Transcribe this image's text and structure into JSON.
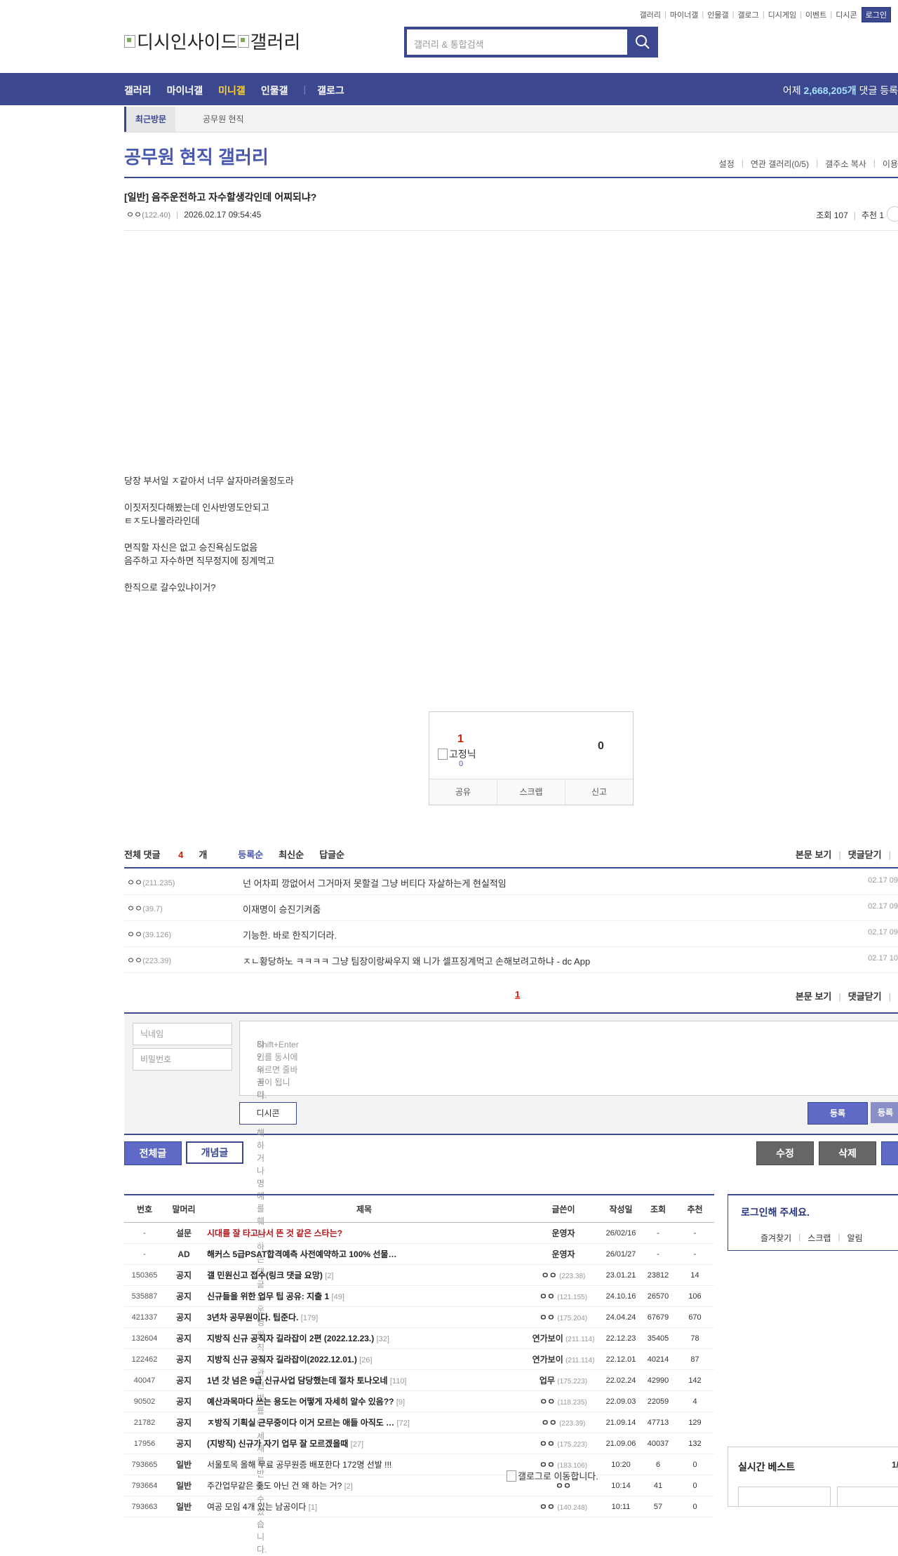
{
  "util_menu": [
    "갤러리",
    "마이너갤",
    "인물갤",
    "갤로그",
    "디시게임",
    "이벤트",
    "디시콘"
  ],
  "login_label": "로그인",
  "logo_alt_1": "디시인사이드",
  "logo_alt_2": "갤러리",
  "search_placeholder": "갤러리 & 통합검색",
  "gnb": {
    "items": [
      "갤러리",
      "마이너갤",
      "미니갤",
      "인물갤",
      "갤로그"
    ],
    "count_prefix": "어제",
    "count_value": "2,668,205개",
    "count_suffix": "댓글 등록"
  },
  "visit": {
    "tab": "최근방문",
    "item": "공무원 현직"
  },
  "gallery_title": "공무원 현직 갤러리",
  "gallery_menu": [
    "설정",
    "연관 갤러리(0/5)",
    "갤주소 복사",
    "이용"
  ],
  "post": {
    "title": "[일반] 음주운전하고 자수할생각인데 어찌되냐?",
    "nick": "ㅇㅇ",
    "ip": "(122.40)",
    "date": "2026.02.17 09:54:45",
    "views": "조회 107",
    "recommend": "추천 1",
    "body": [
      "당장 부서일 ㅈ같아서 너무 살자마려울정도라",
      "",
      "이짓저짓다해봤는데 인사반영도안되고",
      "ㅌㅈ도나몰라라인데",
      "",
      "면직할 자신은 없고 승진욕심도없음",
      "음주하고 자수하면 직무정지에 징계먹고",
      "",
      "한직으로 갈수있냐이거?"
    ]
  },
  "vote": {
    "up": "1",
    "fixed_alt": "고정닉",
    "fixed_count": "0",
    "down": "0",
    "share": "공유",
    "scrap": "스크랩",
    "report": "신고"
  },
  "comments": {
    "total_label": "전체 댓글",
    "total_count": "4",
    "total_unit": "개",
    "sort": [
      "등록순",
      "최신순",
      "답글순"
    ],
    "view_body": "본문 보기",
    "close": "댓글닫기",
    "items": [
      {
        "nick": "ㅇㅇ",
        "ip": "(211.235)",
        "text": "넌 어차피 깡없어서 그거마저 못할걸 그냥 버티다 자살하는게 현실적임",
        "date": "02.17 09"
      },
      {
        "nick": "ㅇㅇ",
        "ip": "(39.7)",
        "text": "이재명이 승진기켜줌",
        "date": "02.17 09"
      },
      {
        "nick": "ㅇㅇ",
        "ip": "(39.126)",
        "text": "기능한. 바로 한직기더라.",
        "date": "02.17 09"
      },
      {
        "nick": "ㅇㅇ",
        "ip": "(223.39)",
        "text": "ㅈㄴ황당하노 ㅋㅋㅋㅋ 그냥 팀장이랑싸우지 왜 니가 셀프징계먹고 손해보려고하냐 - dc App",
        "date": "02.17 10"
      }
    ],
    "page": "1"
  },
  "form": {
    "nick_placeholder": "닉네임",
    "pw_placeholder": "비밀번호",
    "textarea_line1": "타인의 권리를 침해하거나 명예를 훼손하는 댓글은 운영원칙 및 관련 법률에 제재를 받을 수 있습니다.",
    "textarea_line2": "Shift+Enter 키를 동시에 누르면 줄바꿈이 됩니다.",
    "dccon": "디시콘",
    "submit": "등록",
    "submit2": "등록"
  },
  "buttons": {
    "all": "전체글",
    "concept": "개념글",
    "edit": "수정",
    "delete": "삭제"
  },
  "list": {
    "headers": [
      "번호",
      "말머리",
      "제목",
      "글쓴이",
      "작성일",
      "조회",
      "추천"
    ],
    "rows": [
      {
        "no": "-",
        "head": "설문",
        "title": "시대를 잘 타고나서 뜬 것 같은 스타는?",
        "replies": "",
        "writer": "운영자",
        "ip": "",
        "date": "26/02/16",
        "views": "-",
        "rec": "-",
        "style": "red"
      },
      {
        "no": "-",
        "head": "AD",
        "title": "해커스 5급PSAT합격예측 사전예약하고 100% 선물…",
        "replies": "",
        "writer": "운영자",
        "ip": "",
        "date": "26/01/27",
        "views": "-",
        "rec": "-",
        "style": "bold"
      },
      {
        "no": "150365",
        "head": "공지",
        "title": "갤 민원신고 접수(링크 댓글 요망)",
        "replies": "[2]",
        "writer": "ㅇㅇ",
        "ip": "(223.38)",
        "date": "23.01.21",
        "views": "23812",
        "rec": "14",
        "style": "bold"
      },
      {
        "no": "535887",
        "head": "공지",
        "title": "신규들을 위한 업무 팁 공유: 지출 1",
        "replies": "[49]",
        "writer": "ㅇㅇ",
        "ip": "(121.155)",
        "date": "24.10.16",
        "views": "26570",
        "rec": "106",
        "style": "bold"
      },
      {
        "no": "421337",
        "head": "공지",
        "title": "3년차 공무원이다. 팁준다.",
        "replies": "[179]",
        "writer": "ㅇㅇ",
        "ip": "(175.204)",
        "date": "24.04.24",
        "views": "67679",
        "rec": "670",
        "style": "bold"
      },
      {
        "no": "132604",
        "head": "공지",
        "title": "지방직 신규 공직자 길라잡이 2편 (2022.12.23.)",
        "replies": "[32]",
        "writer": "연가보이",
        "ip": "(211.114)",
        "date": "22.12.23",
        "views": "35405",
        "rec": "78",
        "style": "bold"
      },
      {
        "no": "122462",
        "head": "공지",
        "title": "지방직 신규 공직자 길라잡이(2022.12.01.)",
        "replies": "[26]",
        "writer": "연가보이",
        "ip": "(211.114)",
        "date": "22.12.01",
        "views": "40214",
        "rec": "87",
        "style": "bold"
      },
      {
        "no": "40047",
        "head": "공지",
        "title": "1년 갓 넘은 9급 신규사업 담당했는데 절차 토나오네",
        "replies": "[110]",
        "writer": "업무",
        "ip": "(175.223)",
        "date": "22.02.24",
        "views": "42990",
        "rec": "142",
        "style": "bold"
      },
      {
        "no": "90502",
        "head": "공지",
        "title": "예산과목마다 쓰는 용도는 어떻게 자세히 알수 있음??",
        "replies": "[9]",
        "writer": "ㅇㅇ",
        "ip": "(118.235)",
        "date": "22.09.03",
        "views": "22059",
        "rec": "4",
        "style": "bold"
      },
      {
        "no": "21782",
        "head": "공지",
        "title": "ㅈ방직 기획실 근무중이다 이거 모르는 애들 아직도 …",
        "replies": "[72]",
        "writer": "ㅇㅇ",
        "ip": "(223.39)",
        "date": "21.09.14",
        "views": "47713",
        "rec": "129",
        "style": "bold"
      },
      {
        "no": "17956",
        "head": "공지",
        "title": "(지방직) 신규가 자기 업무 잘 모르겠을때",
        "replies": "[27]",
        "writer": "ㅇㅇ",
        "ip": "(175.223)",
        "date": "21.09.06",
        "views": "40037",
        "rec": "132",
        "style": "bold"
      },
      {
        "no": "793665",
        "head": "일반",
        "title": "서울토목 올해 무료 공무원증 배포한다 172명 선발 !!!",
        "replies": "",
        "writer": "ㅇㅇ",
        "ip": "(183.106)",
        "date": "10:20",
        "views": "6",
        "rec": "0",
        "style": "normal"
      },
      {
        "no": "793664",
        "head": "일반",
        "title": "주간업무같은 좆도 아닌 건 왜 하는 거?",
        "replies": "[2]",
        "writer": "ㅇㅇ",
        "ip": "",
        "date": "10:14",
        "views": "41",
        "rec": "0",
        "style": "normal"
      },
      {
        "no": "793663",
        "head": "일반",
        "title": "여공 모임 4개 있는 남공이다",
        "replies": "[1]",
        "writer": "ㅇㅇ",
        "ip": "(140.248)",
        "date": "10:11",
        "views": "57",
        "rec": "0",
        "style": "normal"
      }
    ]
  },
  "galog_alt": "갤로그로 이동합니다.",
  "login_box": {
    "title": "로그인해 주세요.",
    "menu": [
      "즐겨찾기",
      "스크랩",
      "알림"
    ]
  },
  "best": {
    "title": "실시간 베스트",
    "page": "1/"
  }
}
